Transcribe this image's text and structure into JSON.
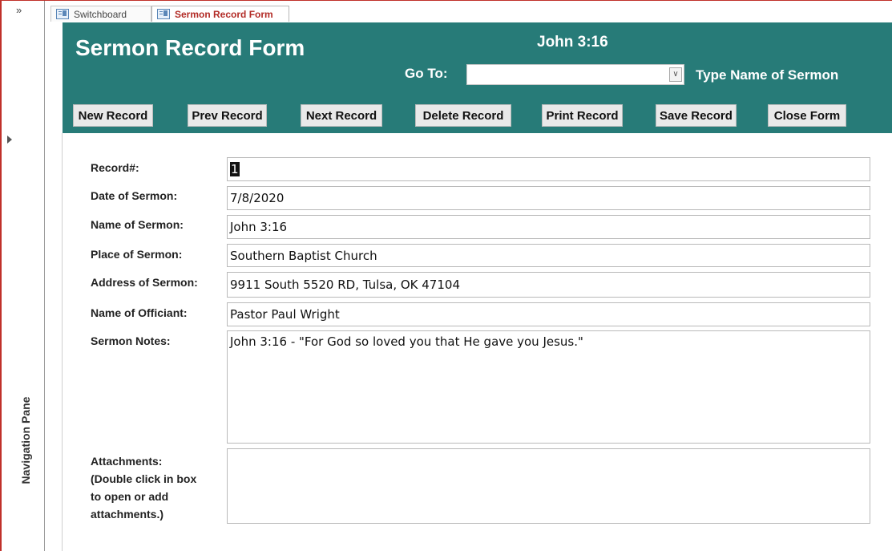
{
  "nav_pane": {
    "toggle": "»",
    "label": "Navigation Pane"
  },
  "tabs": [
    {
      "label": "Switchboard",
      "active": false
    },
    {
      "label": "Sermon Record Form",
      "active": true
    }
  ],
  "header": {
    "title": "Sermon Record Form",
    "current_sermon": "John 3:16",
    "goto_label": "Go To:",
    "goto_value": "",
    "goto_hint": "Type Name of Sermon",
    "background_color": "#277b78"
  },
  "buttons": {
    "new": "New Record",
    "prev": "Prev Record",
    "next": "Next Record",
    "delete": "Delete Record",
    "print": "Print Record",
    "save": "Save Record",
    "close": "Close Form"
  },
  "fields": {
    "record_label": "Record#:",
    "record_value": "1",
    "date_label": "Date of Sermon:",
    "date_value": "7/8/2020",
    "name_label": "Name of Sermon:",
    "name_value": "John 3:16",
    "place_label": "Place of Sermon:",
    "place_value": "Southern Baptist Church",
    "address_label": "Address of Sermon:",
    "address_value": "9911 South 5520 RD, Tulsa, OK 47104",
    "officiant_label": "Name of Officiant:",
    "officiant_value": "Pastor Paul Wright",
    "notes_label": "Sermon Notes:",
    "notes_value": "John 3:16 - \"For God so loved you that He gave you Jesus.\"",
    "attachments_label_1": "Attachments:",
    "attachments_label_2": "(Double click in box",
    "attachments_label_3": "to open or add",
    "attachments_label_4": "attachments.)"
  }
}
